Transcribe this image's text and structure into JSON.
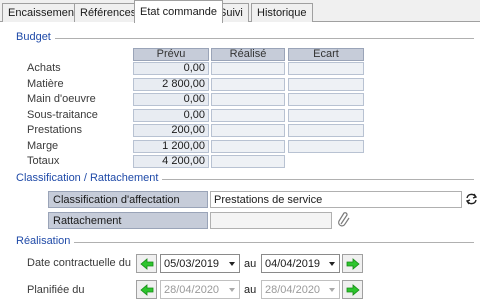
{
  "tabs": [
    "Encaissement",
    "Références",
    "Etat commande",
    "Suivi",
    "Historique"
  ],
  "budget": {
    "title": "Budget",
    "columns": [
      "Prévu",
      "Réalisé",
      "Ecart"
    ],
    "rows": [
      {
        "label": "Achats",
        "prevu": "0,00"
      },
      {
        "label": "Matière",
        "prevu": "2 800,00"
      },
      {
        "label": "Main d'oeuvre",
        "prevu": "0,00"
      },
      {
        "label": "Sous-traitance",
        "prevu": "0,00"
      },
      {
        "label": "Prestations",
        "prevu": "200,00"
      },
      {
        "label": "Marge",
        "prevu": "1 200,00"
      },
      {
        "label": "Totaux",
        "prevu": "4 200,00"
      }
    ]
  },
  "classification": {
    "title": "Classification / Rattachement",
    "affectation_label": "Classification d'affectation",
    "affectation_value": "Prestations de service",
    "rattachement_label": "Rattachement",
    "rattachement_value": ""
  },
  "realisation": {
    "title": "Réalisation",
    "contractuelle_label": "Date contractuelle du",
    "contractuelle_from": "05/03/2019",
    "contractuelle_to": "04/04/2019",
    "planifiee_label": "Planifiée du",
    "planifiee_from": "28/04/2020",
    "planifiee_to": "28/04/2020",
    "au_label": "au"
  },
  "colors": {
    "section": "#1f4aa8",
    "header": "#c6ccd9",
    "arrow": "#2ec52e"
  }
}
